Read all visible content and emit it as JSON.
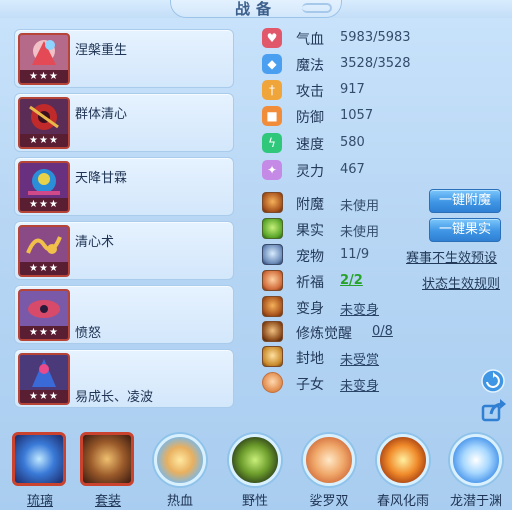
{
  "title": "战备",
  "skills": [
    {
      "name": "涅槃重生",
      "stars": "★★★"
    },
    {
      "name": "群体清心",
      "stars": "★★★"
    },
    {
      "name": "天降甘霖",
      "stars": "★★★"
    },
    {
      "name": "清心术",
      "stars": "★★★"
    },
    {
      "name": "愤怒",
      "stars": "★★★"
    },
    {
      "name": "易成长、凌波",
      "stars": "★★★"
    }
  ],
  "stats": [
    {
      "label": "气血",
      "value": "5983/5983",
      "icon": "heart-icon",
      "color": "#e0586a"
    },
    {
      "label": "魔法",
      "value": "3528/3528",
      "icon": "mana-icon",
      "color": "#4a9ff0"
    },
    {
      "label": "攻击",
      "value": "917",
      "icon": "sword-icon",
      "color": "#f0a53a"
    },
    {
      "label": "防御",
      "value": "1057",
      "icon": "shield-icon",
      "color": "#f08c3a"
    },
    {
      "label": "速度",
      "value": "580",
      "icon": "lightning-icon",
      "color": "#2fc87a"
    },
    {
      "label": "灵力",
      "value": "467",
      "icon": "spirit-icon",
      "color": "#c48ae6"
    }
  ],
  "status": {
    "enchant": {
      "label": "附魔",
      "value": "未使用"
    },
    "fruit": {
      "label": "果实",
      "value": "未使用"
    },
    "pet": {
      "label": "宠物",
      "value": "11/9"
    },
    "blessing": {
      "label": "祈福",
      "value": "2/2"
    },
    "transform": {
      "label": "变身",
      "value": "未变身"
    },
    "cultivation": {
      "label": "修炼觉醒",
      "value": "0/8"
    },
    "fief": {
      "label": "封地",
      "value": "未受赏"
    },
    "child": {
      "label": "子女",
      "value": "未变身"
    }
  },
  "buttons": {
    "auto_enchant": "一键附魔",
    "auto_fruit": "一键果实"
  },
  "links": {
    "event_preset": "赛事不生效预设",
    "status_rules": "状态生效规则"
  },
  "bottom": [
    {
      "label": "琉璃",
      "icon": "glaze-orb-icon"
    },
    {
      "label": "套装",
      "icon": "armor-set-icon"
    },
    {
      "label": "热血",
      "icon": "hotblood-icon"
    },
    {
      "label": "野性",
      "icon": "wild-icon"
    },
    {
      "label": "娑罗双",
      "icon": "sala-icon"
    },
    {
      "label": "春风化雨",
      "icon": "spring-rain-icon"
    },
    {
      "label": "龙潜于渊",
      "icon": "dragon-icon"
    }
  ]
}
